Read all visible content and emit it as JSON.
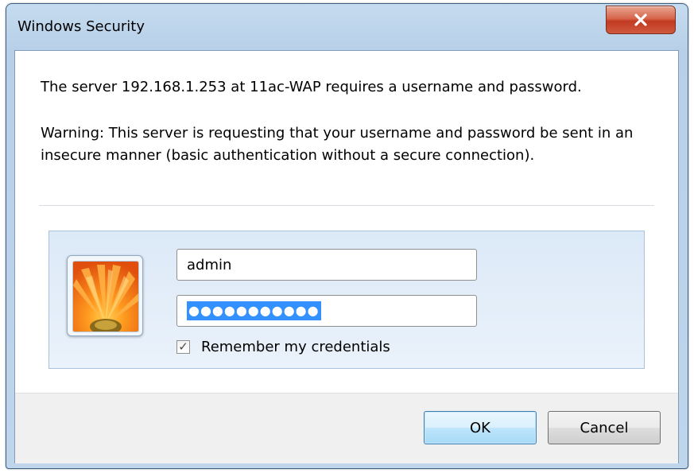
{
  "window": {
    "title": "Windows Security"
  },
  "message": {
    "line1": "The server 192.168.1.253 at 11ac-WAP requires a username and password.",
    "warning": "Warning: This server is requesting that your username and password be sent in an insecure manner (basic authentication without a secure connection)."
  },
  "credentials": {
    "username": "admin",
    "password_mask": "●●●●●●●●●●●",
    "remember_label": "Remember my credentials",
    "remember_checked": true
  },
  "buttons": {
    "ok": "OK",
    "cancel": "Cancel"
  },
  "icons": {
    "close": "close-icon",
    "user_tile": "user-tile-icon",
    "checkbox": "checkmark-icon"
  },
  "colors": {
    "close_button": "#c9452a",
    "selection": "#3390ff",
    "ok_button_border": "#3c7fb1"
  }
}
